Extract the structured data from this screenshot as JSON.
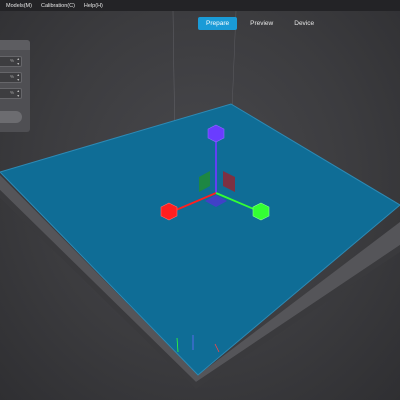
{
  "menu": {
    "items": [
      "Models(M)",
      "Calibration(C)",
      "Help(H)"
    ]
  },
  "tabs": [
    {
      "label": "Prepare",
      "active": true
    },
    {
      "label": "Preview",
      "active": false
    },
    {
      "label": "Device",
      "active": false
    }
  ],
  "panel": {
    "fields": [
      {
        "unit": "%"
      },
      {
        "unit": "%"
      },
      {
        "unit": "%"
      }
    ],
    "spinner_symbols": {
      "up": "▲",
      "down": "▼"
    }
  },
  "scene": {
    "plate_color": "#0f6d96",
    "plate_edge_color": "#525257",
    "axis_colors": {
      "x": "#ff1f1f",
      "y": "#33ff33",
      "z": "#6a3cff"
    }
  }
}
